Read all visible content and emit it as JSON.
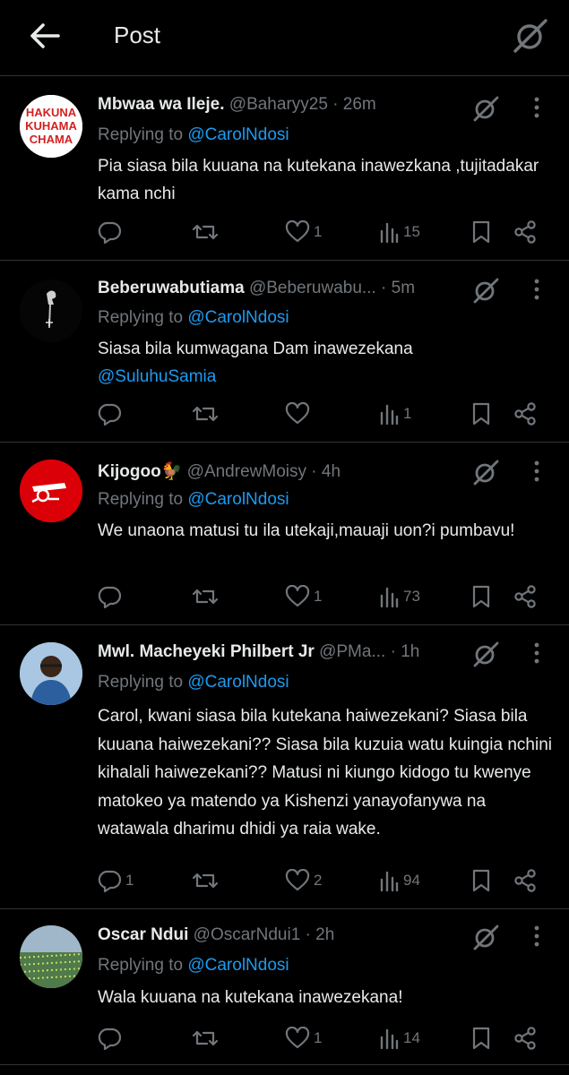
{
  "header": {
    "title": "Post"
  },
  "replies": [
    {
      "name": "Mbwaa wa Ileje.",
      "handle": "@Baharyy25",
      "sep": "·",
      "time": "26m",
      "replying_prefix": "Replying to",
      "replying_to": "@CarolNdosi",
      "text": "Pia siasa bila kuuana na kutekana inawezkana ,tujitadakar kama nchi",
      "mention": "",
      "stats": {
        "replies": "",
        "reposts": "",
        "likes": "1",
        "views": "15"
      },
      "avatar": {
        "type": "banner",
        "lines": [
          "HAKUNA",
          "KUHAMA",
          "CHAMA"
        ],
        "color": "#d42020"
      }
    },
    {
      "name": "Beberuwabutiama",
      "handle": "@Beberuwabu...",
      "sep": "·",
      "time": "5m",
      "replying_prefix": "Replying to",
      "replying_to": "@CarolNdosi",
      "text": "Siasa bila kumwagana Dam inawezekana",
      "mention": "@SuluhuSamia",
      "stats": {
        "replies": "",
        "reposts": "",
        "likes": "",
        "views": "1"
      },
      "avatar": {
        "type": "dark-figure"
      }
    },
    {
      "name": "Kijogoo🐓",
      "handle": "@AndrewMoisy",
      "sep": "·",
      "time": "4h",
      "replying_prefix": "Replying to",
      "replying_to": "@CarolNdosi",
      "text": "We unaona matusi tu ila utekaji,mauaji uon?i pumbavu!",
      "mention": "",
      "stats": {
        "replies": "",
        "reposts": "",
        "likes": "1",
        "views": "73"
      },
      "avatar": {
        "type": "cannon",
        "color": "#db0007"
      }
    },
    {
      "name": "Mwl. Macheyeki Philbert Jr",
      "handle": "@PMa...",
      "sep": "·",
      "time": "1h",
      "replying_prefix": "Replying to",
      "replying_to": "@CarolNdosi",
      "text": "Carol, kwani siasa bila kutekana haiwezekani? Siasa bila kuuana haiwezekani?? Siasa bila kuzuia watu kuingia nchini kihalali haiwezekani?? Matusi ni kiungo kidogo tu kwenye matokeo ya matendo ya Kishenzi yanayofanywa na watawala dharimu dhidi ya raia wake.",
      "mention": "",
      "stats": {
        "replies": "1",
        "reposts": "",
        "likes": "2",
        "views": "94"
      },
      "avatar": {
        "type": "person"
      }
    },
    {
      "name": "Oscar Ndui",
      "handle": "@OscarNdui1",
      "sep": "·",
      "time": "2h",
      "replying_prefix": "Replying to",
      "replying_to": "@CarolNdosi",
      "text": "Wala kuuana na kutekana inawezekana!",
      "mention": "",
      "stats": {
        "replies": "",
        "reposts": "",
        "likes": "1",
        "views": "14"
      },
      "avatar": {
        "type": "crowd"
      }
    }
  ],
  "icons": {
    "back": "arrow-left-icon",
    "grok": "grok-icon",
    "more": "more-vertical-icon",
    "reply": "reply-icon",
    "repost": "repost-icon",
    "like": "heart-icon",
    "views": "views-icon",
    "bookmark": "bookmark-icon",
    "share": "share-icon"
  },
  "colors": {
    "background": "#000000",
    "text": "#e7e9ea",
    "secondary": "#71767b",
    "link": "#1d9bf0",
    "divider": "#2f3336"
  }
}
